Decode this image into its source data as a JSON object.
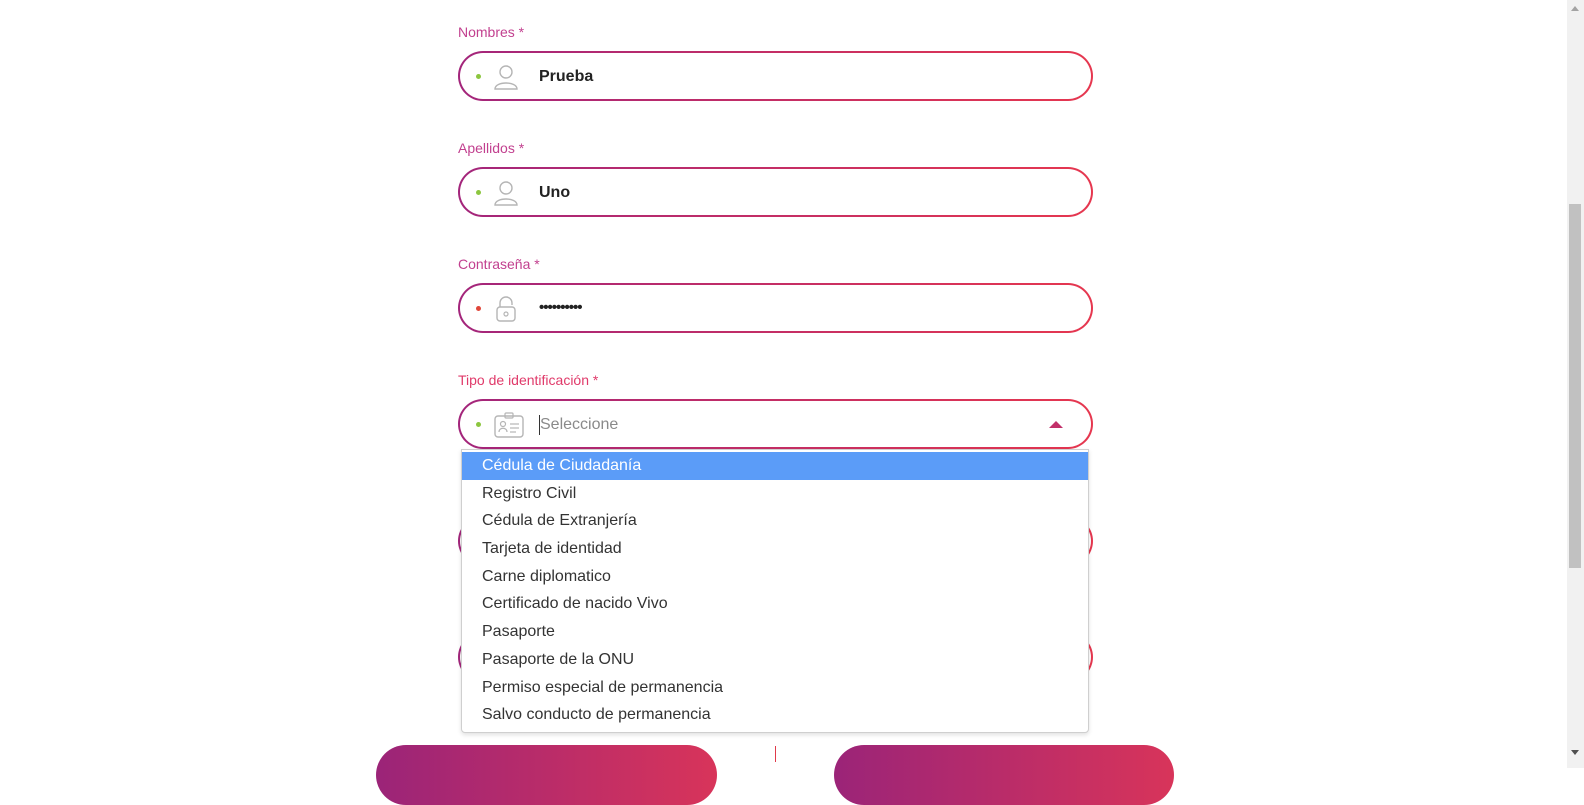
{
  "form": {
    "nombres": {
      "label": "Nombres *",
      "value": "Prueba",
      "icon": "user-icon",
      "status": "valid"
    },
    "apellidos": {
      "label": "Apellidos *",
      "value": "Uno",
      "icon": "user-icon",
      "status": "valid"
    },
    "contrasena": {
      "label": "Contraseña *",
      "value": "••••••••••",
      "icon": "lock-icon",
      "status": "invalid"
    },
    "tipo_identificacion": {
      "label": "Tipo de identificación *",
      "placeholder": "Seleccione",
      "icon": "id-card-icon",
      "status": "valid",
      "options": [
        "Cédula de Ciudadanía",
        "Registro Civil",
        "Cédula de Extranjería",
        "Tarjeta de identidad",
        "Carne diplomatico",
        "Certificado de nacido Vivo",
        "Pasaporte",
        "Pasaporte de la ONU",
        "Permiso especial de permanencia",
        "Salvo conducto de permanencia"
      ],
      "highlighted_option": "Cédula de Ciudadanía"
    }
  },
  "colors": {
    "label": "#c2408f",
    "border_start": "#a3257b",
    "border_end": "#e6374f",
    "valid_dot": "#8cc63f",
    "invalid_dot": "#e0463a",
    "option_highlight": "#5b9cf8"
  }
}
